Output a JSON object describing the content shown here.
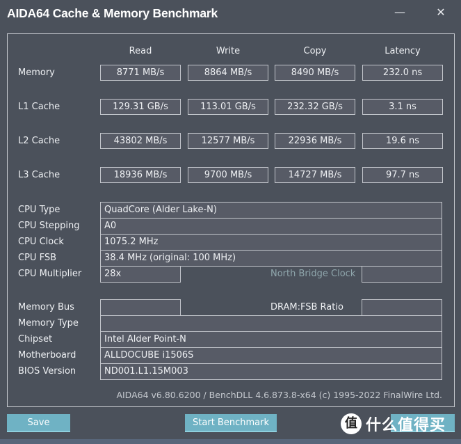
{
  "window": {
    "title": "AIDA64 Cache & Memory Benchmark",
    "minimize_icon": "minimize-icon",
    "close_icon": "close-icon",
    "minimize_glyph": "—",
    "close_glyph": "✕"
  },
  "benchmark": {
    "columns": [
      "Read",
      "Write",
      "Copy",
      "Latency"
    ],
    "rows": [
      {
        "label": "Memory",
        "read": "8771 MB/s",
        "write": "8864 MB/s",
        "copy": "8490 MB/s",
        "latency": "232.0 ns"
      },
      {
        "label": "L1 Cache",
        "read": "129.31 GB/s",
        "write": "113.01 GB/s",
        "copy": "232.32 GB/s",
        "latency": "3.1 ns"
      },
      {
        "label": "L2 Cache",
        "read": "43802 MB/s",
        "write": "12577 MB/s",
        "copy": "22936 MB/s",
        "latency": "19.6 ns"
      },
      {
        "label": "L3 Cache",
        "read": "18936 MB/s",
        "write": "9700 MB/s",
        "copy": "14727 MB/s",
        "latency": "97.7 ns"
      }
    ]
  },
  "cpu_info": {
    "cpu_type": {
      "label": "CPU Type",
      "value": "QuadCore   (Alder Lake-N)"
    },
    "cpu_stepping": {
      "label": "CPU Stepping",
      "value": "A0"
    },
    "cpu_clock": {
      "label": "CPU Clock",
      "value": "1075.2 MHz"
    },
    "cpu_fsb": {
      "label": "CPU FSB",
      "value": "38.4 MHz  (original: 100 MHz)"
    },
    "cpu_multiplier": {
      "label": "CPU Multiplier",
      "value": "28x"
    },
    "north_bridge_clock": {
      "label": "North Bridge Clock",
      "value": ""
    }
  },
  "system_info": {
    "memory_bus": {
      "label": "Memory Bus",
      "value": ""
    },
    "dram_fsb_ratio": {
      "label": "DRAM:FSB Ratio",
      "value": ""
    },
    "memory_type": {
      "label": "Memory Type",
      "value": ""
    },
    "chipset": {
      "label": "Chipset",
      "value": "Intel Alder Point-N"
    },
    "motherboard": {
      "label": "Motherboard",
      "value": "ALLDOCUBE i1506S"
    },
    "bios_version": {
      "label": "BIOS Version",
      "value": "ND001.L1.15M003"
    }
  },
  "footer": {
    "version_text": "AIDA64 v6.80.6200 / BenchDLL 4.6.873.8-x64  (c) 1995-2022 FinalWire Ltd."
  },
  "buttons": {
    "save": "Save",
    "start_benchmark": "Start Benchmark"
  },
  "watermark": {
    "logo_glyph": "值",
    "text": "什么值得买"
  },
  "colors": {
    "background": "#4b515b",
    "field_bg": "#575b66",
    "button_accent": "#6fb2c4",
    "dim_label": "#8fa6ac"
  }
}
